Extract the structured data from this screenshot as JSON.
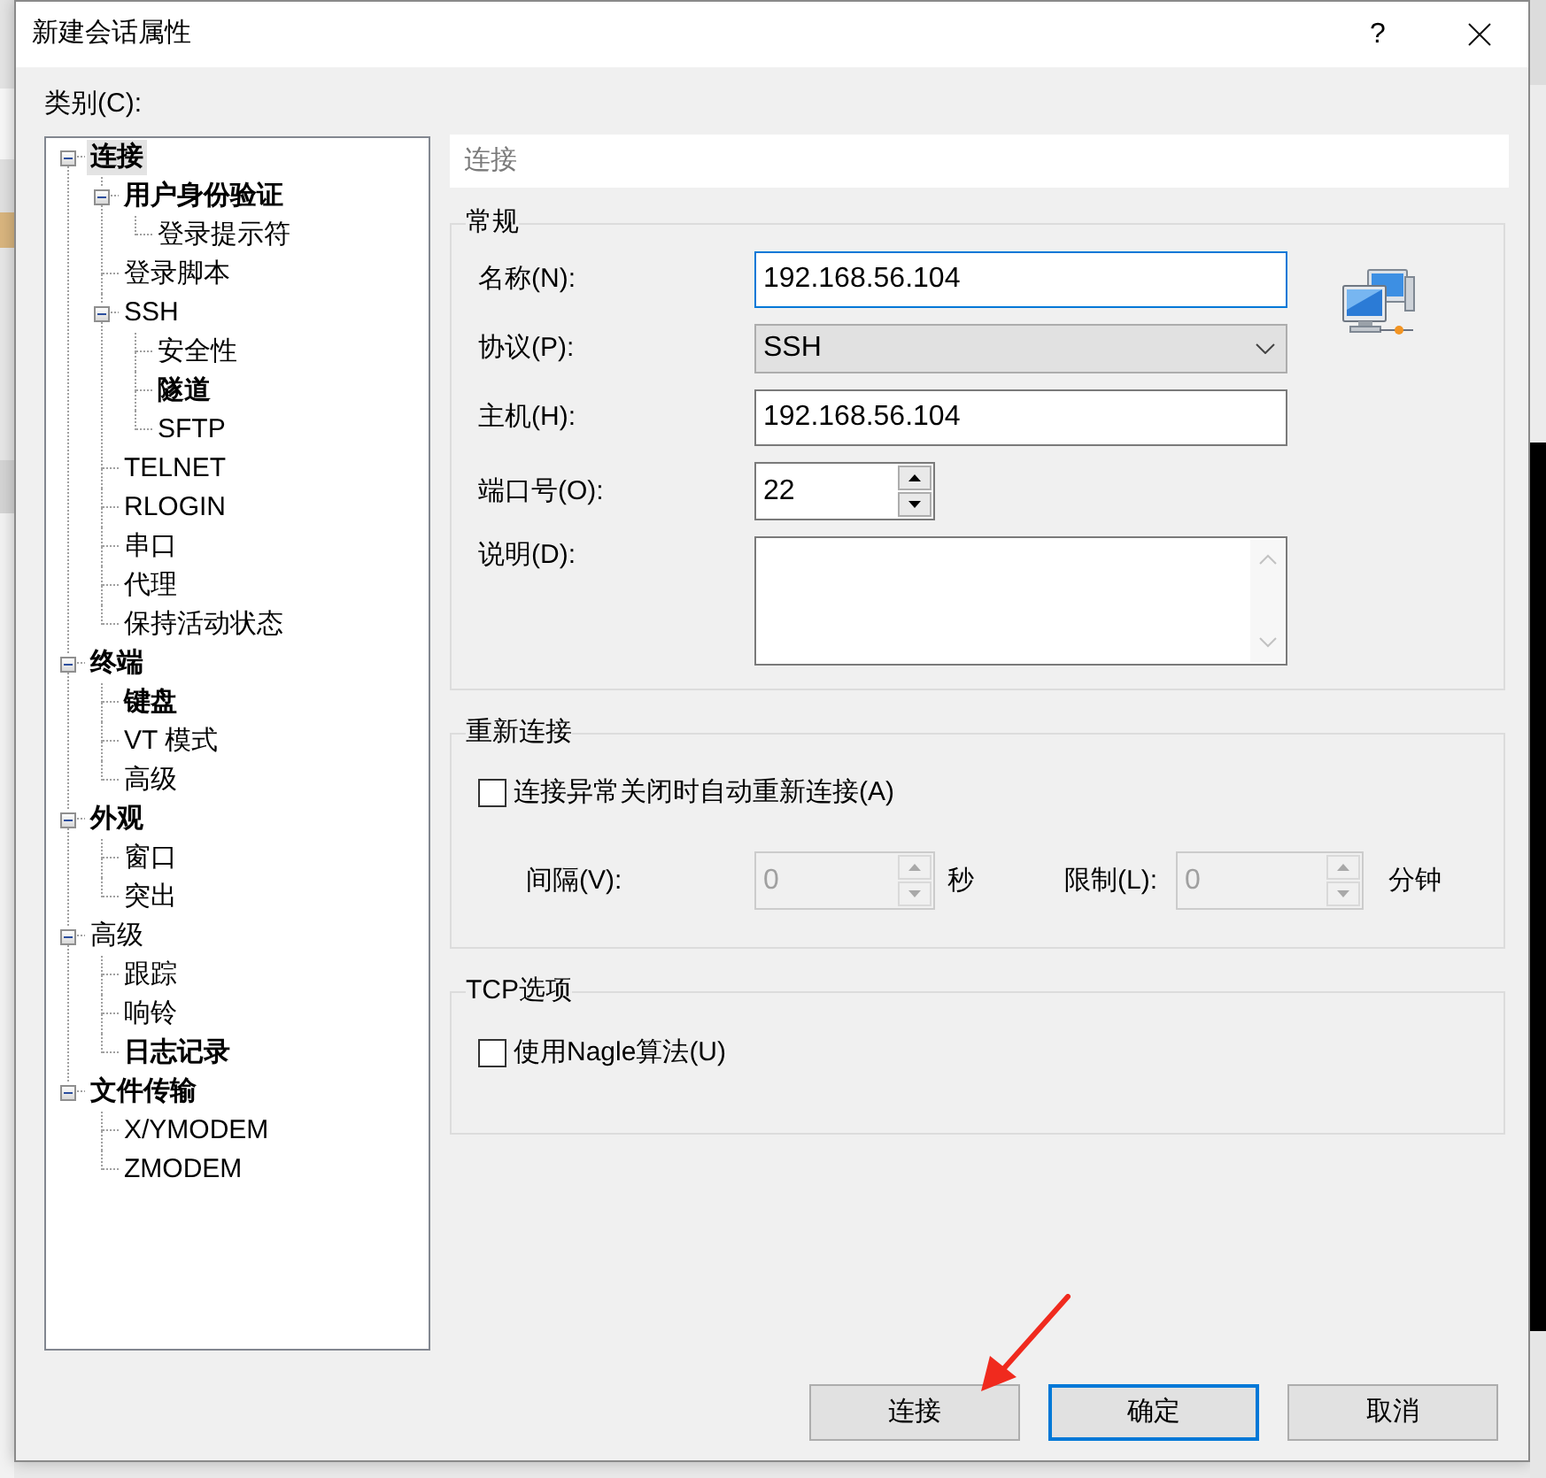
{
  "window": {
    "title": "新建会话属性",
    "help": "?"
  },
  "category": {
    "label": "类别(C):",
    "tree": [
      {
        "label": "连接",
        "bold": true,
        "selected": true,
        "expanded": true,
        "children": [
          {
            "label": "用户身份验证",
            "bold": true,
            "selected": false,
            "expanded": true,
            "children": [
              {
                "label": "登录提示符",
                "bold": false,
                "selected": false
              }
            ]
          },
          {
            "label": "登录脚本",
            "bold": false,
            "selected": false
          },
          {
            "label": "SSH",
            "bold": false,
            "selected": false,
            "expanded": true,
            "children": [
              {
                "label": "安全性",
                "bold": false,
                "selected": false
              },
              {
                "label": "隧道",
                "bold": true,
                "selected": false
              },
              {
                "label": "SFTP",
                "bold": false,
                "selected": false
              }
            ]
          },
          {
            "label": "TELNET",
            "bold": false,
            "selected": false
          },
          {
            "label": "RLOGIN",
            "bold": false,
            "selected": false
          },
          {
            "label": "串口",
            "bold": false,
            "selected": false
          },
          {
            "label": "代理",
            "bold": false,
            "selected": false
          },
          {
            "label": "保持活动状态",
            "bold": false,
            "selected": false
          }
        ]
      },
      {
        "label": "终端",
        "bold": true,
        "selected": false,
        "expanded": true,
        "children": [
          {
            "label": "键盘",
            "bold": true,
            "selected": false
          },
          {
            "label": "VT 模式",
            "bold": false,
            "selected": false
          },
          {
            "label": "高级",
            "bold": false,
            "selected": false
          }
        ]
      },
      {
        "label": "外观",
        "bold": true,
        "selected": false,
        "expanded": true,
        "children": [
          {
            "label": "窗口",
            "bold": false,
            "selected": false
          },
          {
            "label": "突出",
            "bold": false,
            "selected": false
          }
        ]
      },
      {
        "label": "高级",
        "bold": false,
        "selected": false,
        "expanded": true,
        "children": [
          {
            "label": "跟踪",
            "bold": false,
            "selected": false
          },
          {
            "label": "响铃",
            "bold": false,
            "selected": false
          },
          {
            "label": "日志记录",
            "bold": true,
            "selected": false
          }
        ]
      },
      {
        "label": "文件传输",
        "bold": true,
        "selected": false,
        "expanded": true,
        "children": [
          {
            "label": "X/YMODEM",
            "bold": false,
            "selected": false
          },
          {
            "label": "ZMODEM",
            "bold": false,
            "selected": false
          }
        ]
      }
    ]
  },
  "panel": {
    "title": "连接"
  },
  "general": {
    "legend": "常规",
    "fields": [
      {
        "kind": "text",
        "label": "名称(N):",
        "value": "192.168.56.104",
        "focused": true
      },
      {
        "kind": "select",
        "label": "协议(P):",
        "value": "SSH"
      },
      {
        "kind": "text",
        "label": "主机(H):",
        "value": "192.168.56.104",
        "focused": false
      },
      {
        "kind": "spinner",
        "label": "端口号(O):",
        "value": "22"
      },
      {
        "kind": "textarea",
        "label": "说明(D):"
      }
    ]
  },
  "reconnect": {
    "legend": "重新连接",
    "checkbox": {
      "label": "连接异常关闭时自动重新连接(A)",
      "checked": false
    },
    "interval": {
      "label": "间隔(V):",
      "value": "0",
      "unit": "秒",
      "disabled": true
    },
    "limit": {
      "label": "限制(L):",
      "value": "0",
      "unit": "分钟",
      "disabled": true
    }
  },
  "tcp": {
    "legend": "TCP选项",
    "checkbox": {
      "label": "使用Nagle算法(U)",
      "checked": false
    }
  },
  "buttons": [
    {
      "label": "连接",
      "default": false
    },
    {
      "label": "确定",
      "default": true
    },
    {
      "label": "取消",
      "default": false
    }
  ]
}
